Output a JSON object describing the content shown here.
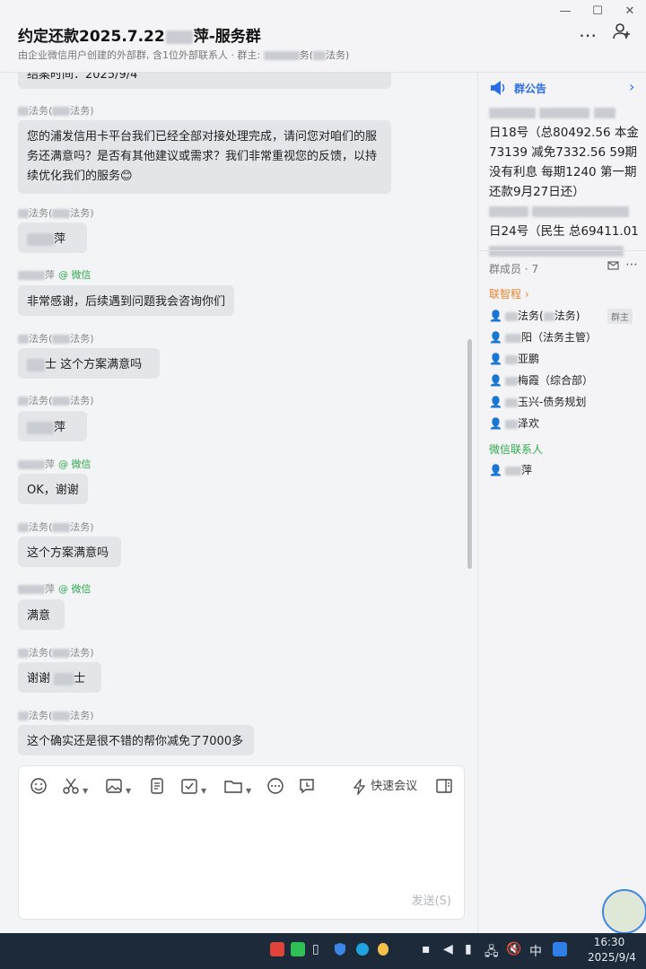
{
  "header": {
    "title": "约定还款2025.7.22█萍-服务群",
    "subtitle": "由企业微信用户创建的外部群, 含1位外部联系人 · 群主: ██务(█法务)",
    "window_controls": {
      "minimize": "—",
      "maximize": "☐",
      "close": "✕"
    },
    "more_icon": "more-dots-icon",
    "add_member_icon": "add-member-icon"
  },
  "chat": {
    "partial_top": "结案时间：2025/9/4",
    "messages": [
      {
        "sender": "█法务(█法务)",
        "text": "您的浦发信用卡平台我们已经全部对接处理完成，请问您对咱们的服务还满意吗？是否有其他建议或需求？我们非常重视您的反馈，以持续优化我们的服务😊"
      },
      {
        "sender": "█法务(█法务)",
        "text": "█萍"
      },
      {
        "sender": "█萍",
        "wechat_tag": "@ 微信",
        "text": "非常感谢，后续遇到问题我会咨询你们"
      },
      {
        "sender": "█法务(█法务)",
        "text": "█士 这个方案满意吗"
      },
      {
        "sender": "█法务(█法务)",
        "text": "█萍"
      },
      {
        "sender": "█萍",
        "wechat_tag": "@ 微信",
        "text": "OK，谢谢"
      },
      {
        "sender": "█法务(█法务)",
        "text": "这个方案满意吗"
      },
      {
        "sender": "█萍",
        "wechat_tag": "@ 微信",
        "text": "满意"
      },
      {
        "sender": "█法务(█法务)",
        "text": "谢谢 █士"
      },
      {
        "sender": "█法务(█法务)",
        "text": "这个确实还是很不错的帮你减免了7000多"
      }
    ]
  },
  "composer": {
    "tools": [
      "emoji-icon",
      "scissors-icon",
      "image-icon",
      "doc-icon",
      "task-icon",
      "folder-icon",
      "more-icon",
      "history-icon"
    ],
    "quick_meeting_label": "快速会议",
    "send_label": "发送(S)"
  },
  "right_panel": {
    "notice_title": "群公告",
    "notice_lines": [
      "█ █ █",
      "日18号（总80492.56 本金73139 减免7332.56 59期没有利息 每期1240 第一期还款9月27日还）",
      "█ █",
      "日24号（民生 总69411.01",
      "█ █ █"
    ],
    "members_title": "群成员 · 7",
    "group_lianzhi": "联智程 ›",
    "members": [
      {
        "name": "█法务(█法务)",
        "badge": "群主"
      },
      {
        "name": "█阳（法务主管）"
      },
      {
        "name": "█亚鹏"
      },
      {
        "name": "█梅霞（综合部）"
      },
      {
        "name": "█玉兴-债务规划"
      },
      {
        "name": "█泽欢"
      }
    ],
    "wechat_contacts_title": "微信联系人",
    "wechat_contacts": [
      {
        "name": "█萍"
      }
    ]
  },
  "taskbar": {
    "time": "16:30",
    "date": "2025/9/4",
    "ime": "中"
  }
}
